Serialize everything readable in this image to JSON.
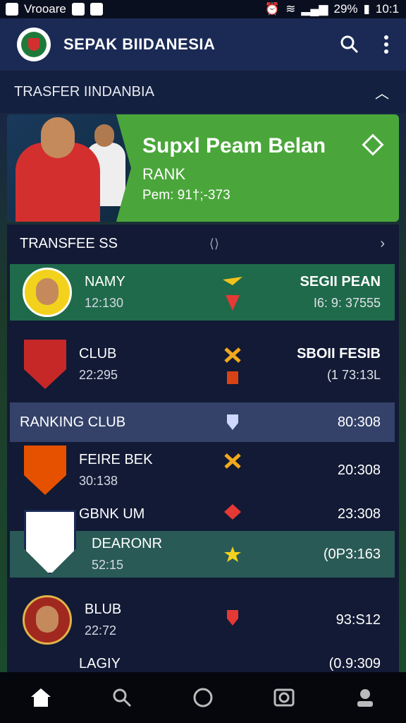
{
  "status_bar": {
    "left_text": "Vrooare",
    "battery": "29%",
    "time": "10:1"
  },
  "app_bar": {
    "title": "SEPAK BIIDANESIA"
  },
  "section": {
    "title": "TRASFER IINDANBIA"
  },
  "hero": {
    "title": "Supxl Peam Belan",
    "subtitle": "RANK",
    "stats": "Pem: 91†;-373"
  },
  "transfers": {
    "header": "TRANSFEE SS",
    "rows": [
      {
        "name": "NAMY",
        "value": "12:130",
        "right_title": "SEGII PEAN",
        "right_value": "I6: 9: 37555"
      },
      {
        "name": "CLUB",
        "value": "22:295",
        "right_title": "SBOII FESIB",
        "right_value": "(1 73:13L"
      }
    ]
  },
  "ranking": {
    "header": "RANKING CLUB",
    "header_value": "80:308",
    "rows": [
      {
        "name": "FEIRE BEK",
        "value": "30:138",
        "right_value": "20:308"
      },
      {
        "name": "GBNK UM",
        "value": "",
        "right_value": "23:308"
      },
      {
        "name": "DEARONR",
        "value": "52:15",
        "right_value": "(0P3:163"
      },
      {
        "name": "BLUB",
        "value": "22:72",
        "right_value": "93:S12"
      },
      {
        "name": "LAGIY",
        "value": "",
        "right_value": "(0.9:309"
      }
    ]
  },
  "icons": [
    "search-icon",
    "more-vert-icon",
    "chevron-up-icon",
    "diamond-icon",
    "chevron-right-icon",
    "home-icon",
    "circle-icon",
    "camera-icon",
    "profile-icon"
  ]
}
